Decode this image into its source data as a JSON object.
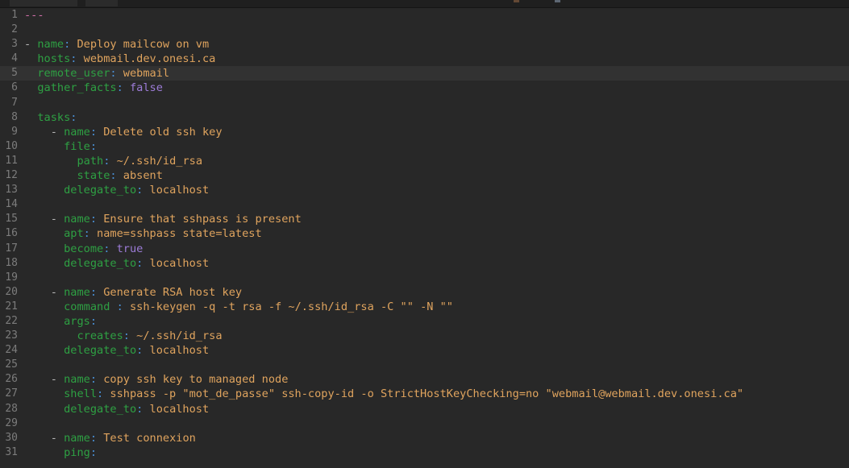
{
  "window": {
    "chrome": {
      "tabs": [
        {
          "name": "editor-tab-primary"
        },
        {
          "name": "editor-tab-secondary"
        }
      ],
      "icons": [
        "toolbar-icon-amber",
        "toolbar-icon-blue"
      ]
    }
  },
  "editor": {
    "language": "yaml",
    "active_line": 5,
    "first_visible_line": 1,
    "last_visible_line": 31,
    "colors": {
      "background": "#282828",
      "gutter_background": "#282828",
      "active_line_background": "#323232",
      "line_number": "#7c7c7c",
      "key": "#2ea043",
      "punctuation": "#4a8fd4",
      "value": "#e0a45e",
      "boolean": "#9d7cd8",
      "dash": "#b8b8b8",
      "document_start": "#d06fa8",
      "plain_text": "#d4d4d4"
    },
    "lines": [
      {
        "n": 1,
        "tokens": [
          {
            "t": "doc",
            "s": "---"
          }
        ]
      },
      {
        "n": 2,
        "tokens": []
      },
      {
        "n": 3,
        "tokens": [
          {
            "t": "dash",
            "s": "- "
          },
          {
            "t": "key",
            "s": "name"
          },
          {
            "t": "punc",
            "s": ":"
          },
          {
            "t": "val",
            "s": " Deploy mailcow on vm"
          }
        ]
      },
      {
        "n": 4,
        "tokens": [
          {
            "t": "plain",
            "s": "  "
          },
          {
            "t": "key",
            "s": "hosts"
          },
          {
            "t": "punc",
            "s": ":"
          },
          {
            "t": "val",
            "s": " webmail.dev.onesi.ca"
          }
        ]
      },
      {
        "n": 5,
        "tokens": [
          {
            "t": "plain",
            "s": "  "
          },
          {
            "t": "key",
            "s": "remote_user"
          },
          {
            "t": "punc",
            "s": ":"
          },
          {
            "t": "val",
            "s": " webmail"
          }
        ]
      },
      {
        "n": 6,
        "tokens": [
          {
            "t": "plain",
            "s": "  "
          },
          {
            "t": "key",
            "s": "gather_facts"
          },
          {
            "t": "punc",
            "s": ":"
          },
          {
            "t": "bool",
            "s": " false"
          }
        ]
      },
      {
        "n": 7,
        "tokens": []
      },
      {
        "n": 8,
        "tokens": [
          {
            "t": "plain",
            "s": "  "
          },
          {
            "t": "key",
            "s": "tasks"
          },
          {
            "t": "punc",
            "s": ":"
          }
        ]
      },
      {
        "n": 9,
        "tokens": [
          {
            "t": "dash",
            "s": "    - "
          },
          {
            "t": "key",
            "s": "name"
          },
          {
            "t": "punc",
            "s": ":"
          },
          {
            "t": "val",
            "s": " Delete old ssh key"
          }
        ]
      },
      {
        "n": 10,
        "tokens": [
          {
            "t": "plain",
            "s": "      "
          },
          {
            "t": "key",
            "s": "file"
          },
          {
            "t": "punc",
            "s": ":"
          }
        ]
      },
      {
        "n": 11,
        "tokens": [
          {
            "t": "plain",
            "s": "        "
          },
          {
            "t": "key",
            "s": "path"
          },
          {
            "t": "punc",
            "s": ":"
          },
          {
            "t": "val",
            "s": " ~/.ssh/id_rsa"
          }
        ]
      },
      {
        "n": 12,
        "tokens": [
          {
            "t": "plain",
            "s": "        "
          },
          {
            "t": "key",
            "s": "state"
          },
          {
            "t": "punc",
            "s": ":"
          },
          {
            "t": "val",
            "s": " absent"
          }
        ]
      },
      {
        "n": 13,
        "tokens": [
          {
            "t": "plain",
            "s": "      "
          },
          {
            "t": "key",
            "s": "delegate_to"
          },
          {
            "t": "punc",
            "s": ":"
          },
          {
            "t": "val",
            "s": " localhost"
          }
        ]
      },
      {
        "n": 14,
        "tokens": []
      },
      {
        "n": 15,
        "tokens": [
          {
            "t": "dash",
            "s": "    - "
          },
          {
            "t": "key",
            "s": "name"
          },
          {
            "t": "punc",
            "s": ":"
          },
          {
            "t": "val",
            "s": " Ensure that sshpass is present"
          }
        ]
      },
      {
        "n": 16,
        "tokens": [
          {
            "t": "plain",
            "s": "      "
          },
          {
            "t": "key",
            "s": "apt"
          },
          {
            "t": "punc",
            "s": ":"
          },
          {
            "t": "val",
            "s": " name=sshpass state=latest"
          }
        ]
      },
      {
        "n": 17,
        "tokens": [
          {
            "t": "plain",
            "s": "      "
          },
          {
            "t": "key",
            "s": "become"
          },
          {
            "t": "punc",
            "s": ":"
          },
          {
            "t": "bool",
            "s": " true"
          }
        ]
      },
      {
        "n": 18,
        "tokens": [
          {
            "t": "plain",
            "s": "      "
          },
          {
            "t": "key",
            "s": "delegate_to"
          },
          {
            "t": "punc",
            "s": ":"
          },
          {
            "t": "val",
            "s": " localhost"
          }
        ]
      },
      {
        "n": 19,
        "tokens": []
      },
      {
        "n": 20,
        "tokens": [
          {
            "t": "dash",
            "s": "    - "
          },
          {
            "t": "key",
            "s": "name"
          },
          {
            "t": "punc",
            "s": ":"
          },
          {
            "t": "val",
            "s": " Generate RSA host key"
          }
        ]
      },
      {
        "n": 21,
        "tokens": [
          {
            "t": "plain",
            "s": "      "
          },
          {
            "t": "key",
            "s": "command"
          },
          {
            "t": "punc",
            "s": " :"
          },
          {
            "t": "val",
            "s": " ssh-keygen -q -t rsa -f ~/.ssh/id_rsa -C \"\" -N \"\""
          }
        ]
      },
      {
        "n": 22,
        "tokens": [
          {
            "t": "plain",
            "s": "      "
          },
          {
            "t": "key",
            "s": "args"
          },
          {
            "t": "punc",
            "s": ":"
          }
        ]
      },
      {
        "n": 23,
        "tokens": [
          {
            "t": "plain",
            "s": "        "
          },
          {
            "t": "key",
            "s": "creates"
          },
          {
            "t": "punc",
            "s": ":"
          },
          {
            "t": "val",
            "s": " ~/.ssh/id_rsa"
          }
        ]
      },
      {
        "n": 24,
        "tokens": [
          {
            "t": "plain",
            "s": "      "
          },
          {
            "t": "key",
            "s": "delegate_to"
          },
          {
            "t": "punc",
            "s": ":"
          },
          {
            "t": "val",
            "s": " localhost"
          }
        ]
      },
      {
        "n": 25,
        "tokens": []
      },
      {
        "n": 26,
        "tokens": [
          {
            "t": "dash",
            "s": "    - "
          },
          {
            "t": "key",
            "s": "name"
          },
          {
            "t": "punc",
            "s": ":"
          },
          {
            "t": "val",
            "s": " copy ssh key to managed node"
          }
        ]
      },
      {
        "n": 27,
        "tokens": [
          {
            "t": "plain",
            "s": "      "
          },
          {
            "t": "key",
            "s": "shell"
          },
          {
            "t": "punc",
            "s": ":"
          },
          {
            "t": "val",
            "s": " sshpass -p \"mot_de_passe\" ssh-copy-id -o StrictHostKeyChecking=no \"webmail@webmail.dev.onesi.ca\""
          }
        ]
      },
      {
        "n": 28,
        "tokens": [
          {
            "t": "plain",
            "s": "      "
          },
          {
            "t": "key",
            "s": "delegate_to"
          },
          {
            "t": "punc",
            "s": ":"
          },
          {
            "t": "val",
            "s": " localhost"
          }
        ]
      },
      {
        "n": 29,
        "tokens": []
      },
      {
        "n": 30,
        "tokens": [
          {
            "t": "dash",
            "s": "    - "
          },
          {
            "t": "key",
            "s": "name"
          },
          {
            "t": "punc",
            "s": ":"
          },
          {
            "t": "val",
            "s": " Test connexion"
          }
        ]
      },
      {
        "n": 31,
        "tokens": [
          {
            "t": "plain",
            "s": "      "
          },
          {
            "t": "key",
            "s": "ping"
          },
          {
            "t": "punc",
            "s": ":"
          }
        ]
      }
    ]
  }
}
